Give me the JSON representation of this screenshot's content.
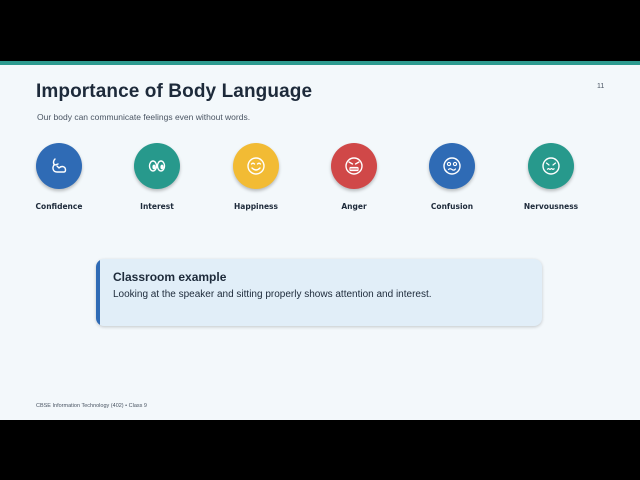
{
  "slide": {
    "title": "Importance of Body Language",
    "subtitle": "Our body can communicate feelings even without words.",
    "number": "11",
    "footer": "CBSE Information Technology (402) • Class 9"
  },
  "emotions": [
    {
      "label": "Confidence",
      "icon": "arm-flex-icon",
      "color": "#2f6bb5"
    },
    {
      "label": "Interest",
      "icon": "eyes-icon",
      "color": "#27998c"
    },
    {
      "label": "Happiness",
      "icon": "smile-face-icon",
      "color": "#f2bb34"
    },
    {
      "label": "Anger",
      "icon": "angry-face-icon",
      "color": "#d04848"
    },
    {
      "label": "Confusion",
      "icon": "confused-face-icon",
      "color": "#2f6bb5"
    },
    {
      "label": "Nervousness",
      "icon": "nervous-face-icon",
      "color": "#27998c"
    }
  ],
  "callout": {
    "title": "Classroom example",
    "text": "Looking at the speaker and sitting properly shows attention and interest.",
    "accent": "#2f6bb5"
  },
  "colors": {
    "accent_bar": "#2c9a8f",
    "background": "#f3f8fb"
  }
}
